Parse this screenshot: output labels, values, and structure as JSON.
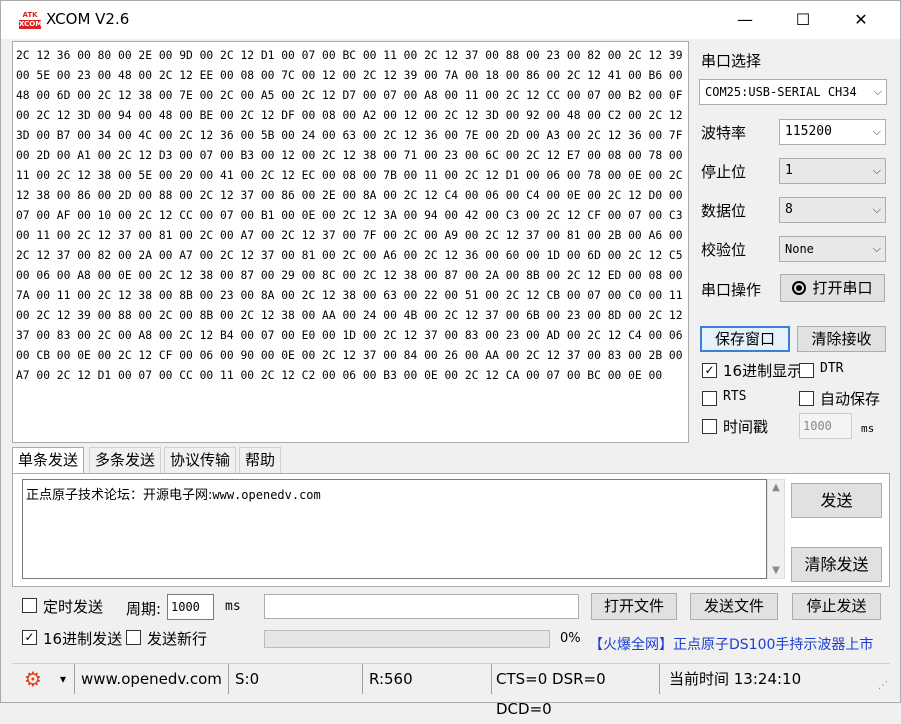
{
  "window": {
    "logo_top": "ATK",
    "logo_bottom": "XCOM",
    "title": "XCOM V2.6",
    "minimize": "—",
    "maximize": "☐",
    "close": "✕"
  },
  "receive": {
    "hex": "2C 12 36 00 80 00 2E 00 9D 00 2C 12 D1 00 07 00 BC 00 11 00 2C 12 37 00 88 00 23 00 82 00 2C 12 39 00 5E 00 23 00 48 00 2C 12 EE 00 08 00 7C 00 12 00 2C 12 39 00 7A 00 18 00 86 00 2C 12 41 00 B6 00 48 00 6D 00 2C 12 38 00 7E 00 2C 00 A5 00 2C 12 D7 00 07 00 A8 00 11 00 2C 12 CC 00 07 00 B2 00 0F 00 2C 12 3D 00 94 00 48 00 BE 00 2C 12 DF 00 08 00 A2 00 12 00 2C 12 3D 00 92 00 48 00 C2 00 2C 12 3D 00 B7 00 34 00 4C 00 2C 12 36 00 5B 00 24 00 63 00 2C 12 36 00 7E 00 2D 00 A3 00 2C 12 36 00 7F 00 2D 00 A1 00 2C 12 D3 00 07 00 B3 00 12 00 2C 12 38 00 71 00 23 00 6C 00 2C 12 E7 00 08 00 78 00 11 00 2C 12 38 00 5E 00 20 00 41 00 2C 12 EC 00 08 00 7B 00 11 00 2C 12 D1 00 06 00 78 00 0E 00 2C 12 38 00 86 00 2D 00 88 00 2C 12 37 00 86 00 2E 00 8A 00 2C 12 C4 00 06 00 C4 00 0E 00 2C 12 D0 00 07 00 AF 00 10 00 2C 12 CC 00 07 00 B1 00 0E 00 2C 12 3A 00 94 00 42 00 C3 00 2C 12 CF 00 07 00 C3 00 11 00 2C 12 37 00 81 00 2C 00 A7 00 2C 12 37 00 7F 00 2C 00 A9 00 2C 12 37 00 81 00 2B 00 A6 00 2C 12 37 00 82 00 2A 00 A7 00 2C 12 37 00 81 00 2C 00 A6 00 2C 12 36 00 60 00 1D 00 6D 00 2C 12 C5 00 06 00 A8 00 0E 00 2C 12 38 00 87 00 29 00 8C 00 2C 12 38 00 87 00 2A 00 8B 00 2C 12 ED 00 08 00 7A 00 11 00 2C 12 38 00 8B 00 23 00 8A 00 2C 12 38 00 63 00 22 00 51 00 2C 12 CB 00 07 00 C0 00 11 00 2C 12 39 00 88 00 2C 00 8B 00 2C 12 38 00 AA 00 24 00 4B 00 2C 12 37 00 6B 00 23 00 8D 00 2C 12 37 00 83 00 2C 00 A8 00 2C 12 B4 00 07 00 E0 00 1D 00 2C 12 37 00 83 00 23 00 AD 00 2C 12 C4 00 06 00 CB 00 0E 00 2C 12 CF 00 06 00 90 00 0E 00 2C 12 37 00 84 00 26 00 AA 00 2C 12 37 00 83 00 2B 00 A7 00 2C 12 D1 00 07 00 CC 00 11 00 2C 12 C2 00 06 00 B3 00 0E 00 2C 12 CA 00 07 00 BC 00 0E 00"
  },
  "settings": {
    "port_select_label": "串口选择",
    "port_value": "COM25:USB-SERIAL CH34",
    "baud_label": "波特率",
    "baud_value": "115200",
    "stopbits_label": "停止位",
    "stopbits_value": "1",
    "databits_label": "数据位",
    "databits_value": "8",
    "parity_label": "校验位",
    "parity_value": "None",
    "port_op_label": "串口操作",
    "open_port_button": "打开串口",
    "save_window_button": "保存窗口",
    "clear_receive_button": "清除接收",
    "hex_display_label": "16进制显示",
    "hex_display_checked": true,
    "dtr_label": "DTR",
    "rts_label": "RTS",
    "autosave_label": "自动保存",
    "timestamp_label": "时间戳",
    "timestamp_value": "1000",
    "timestamp_unit": "ms"
  },
  "tabs": [
    "单条发送",
    "多条发送",
    "协议传输",
    "帮助"
  ],
  "send": {
    "text_cn": "正点原子技术论坛：开源电子网:",
    "text_url": "www.openedv.com",
    "send_button": "发送",
    "clear_send_button": "清除发送",
    "scroll_up": "▲",
    "scroll_down": "▼"
  },
  "bottom": {
    "timed_send_label": "定时发送",
    "period_label": "周期:",
    "period_value": "1000",
    "period_unit": "ms",
    "open_file_button": "打开文件",
    "send_file_button": "发送文件",
    "stop_send_button": "停止发送",
    "hex_send_label": "16进制发送",
    "hex_send_checked": true,
    "newline_label": "发送新行",
    "progress_percent": "0%",
    "progress_value": 0,
    "promo_text": "【火爆全网】正点原子DS100手持示波器上市"
  },
  "status": {
    "settings_icon": "gear-icon",
    "website": "www.openedv.com",
    "sent": "S:0",
    "received": "R:560",
    "lines": "CTS=0 DSR=0 DCD=0",
    "time": "当前时间 13:24:10",
    "dropdown_arrow": "▾"
  }
}
